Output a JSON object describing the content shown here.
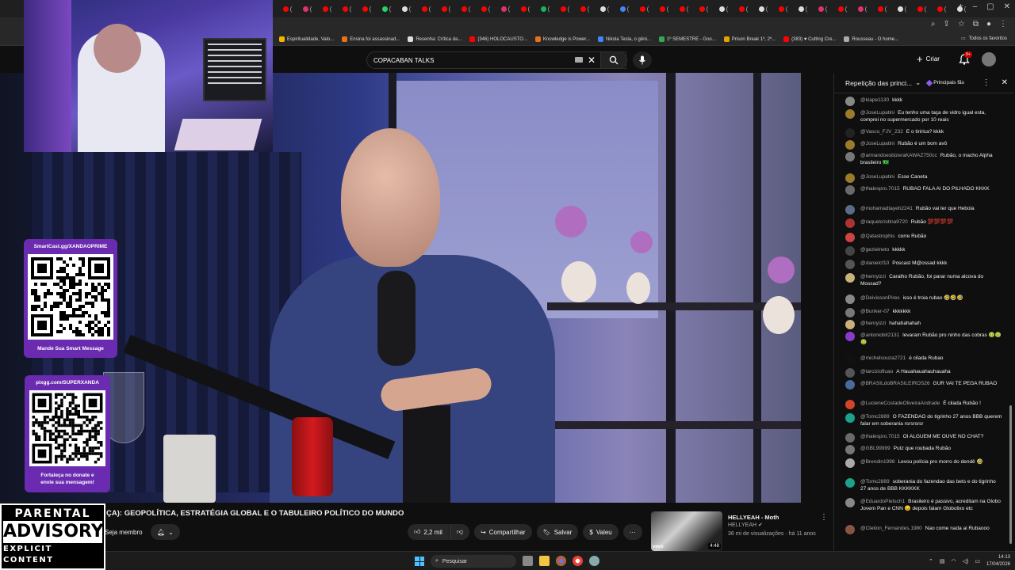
{
  "browser": {
    "tab_count": 38,
    "tab_colors": [
      "#ff0000",
      "#e1306c",
      "#ff0000",
      "#ff0000",
      "#ff0000",
      "#25d366",
      "#dddddd",
      "#ff0000",
      "#ff0000",
      "#ff0000",
      "#ff0000",
      "#e1306c",
      "#ff0000",
      "#19b35c",
      "#ff0000",
      "#ff0000",
      "#dddddd",
      "#4285f4",
      "#ff0000",
      "#ff0000",
      "#ff0000",
      "#ff0000",
      "#dddddd",
      "#ff0000",
      "#dddddd",
      "#ff0000",
      "#dddddd",
      "#e1306c",
      "#ff0000",
      "#e1306c",
      "#ff0000",
      "#dddddd",
      "#ff0000",
      "#ff0000",
      "#dddddd"
    ],
    "new_tab_label": "+",
    "bookmarks": [
      {
        "label": "Espiritualidade, Valo...",
        "color": "#f4b400"
      },
      {
        "label": "Ensina foi assassinad...",
        "color": "#e8711a"
      },
      {
        "label": "Resenha: Crítica da...",
        "color": "#dddddd"
      },
      {
        "label": "(346) HOLOCAUSTO...",
        "color": "#ff0000"
      },
      {
        "label": "Knowledge is Power...",
        "color": "#e8711a"
      },
      {
        "label": "Nikola Tesla, o gêni...",
        "color": "#4285f4"
      },
      {
        "label": "1º SEMESTRE - Goo...",
        "color": "#34a853"
      },
      {
        "label": "Prison Break 1º, 2º...",
        "color": "#e8a200"
      },
      {
        "label": "(383) ♥ Cutting Cre...",
        "color": "#ff0000"
      },
      {
        "label": "Rousseau - O home...",
        "color": "#aaaaaa"
      }
    ],
    "all_favorites": "Todos os favoritos"
  },
  "youtube": {
    "search_value": "COPACABAN TALKS",
    "create_label": "Criar",
    "notif_badge": "9+"
  },
  "overlay": {
    "smartcast": {
      "title": "SmartCast.gg/XANDAOPRIME",
      "footer": "Mande Sua Smart Message"
    },
    "pix": {
      "title": "pixgg.com/SUPERXANDA",
      "footer_line1": "Fortaleça no donate e",
      "footer_line2": "envie sua mensagem!"
    },
    "parental": {
      "line1": "PARENTAL",
      "line2": "ADVISORY",
      "line3": "EXPLICIT CONTENT"
    }
  },
  "video": {
    "title": "ÇA): GEOPOLÍTICA, ESTRATÉGIA GLOBAL E O TABULEIRO POLÍTICO DO MUNDO",
    "join_label": "Seja membro",
    "likes": "2,2 mil",
    "share_label": "Compartilhar",
    "save_label": "Salvar",
    "thanks_label": "Valeu"
  },
  "recommended": {
    "title": "HELLYEAH - Moth",
    "channel": "HELLYEAH",
    "meta": "36 mi de visualizações · há 11 anos",
    "duration": "4:48",
    "badge": "vevo"
  },
  "chat": {
    "header": "Repetição das princi...",
    "top_label": "Principais fãs",
    "messages": [
      {
        "author": "@kiape1130",
        "text": "kkkk",
        "color": "#888888"
      },
      {
        "author": "@JoseLupatini",
        "text": "Eu tenho uma taça de vidro igual esta, comprei no supermercado por 10 reais",
        "color": "#9b7a2a"
      },
      {
        "author": "@Vasco_FJV_232",
        "text": "E o tiririca? kkkk",
        "color": "#222222"
      },
      {
        "author": "@JoseLupatini",
        "text": "Rubão é um bom avô",
        "color": "#9b7a2a"
      },
      {
        "author": "@armandoesbizeraKAWAZ750cc",
        "text": "Rubão, o macho Alpha brasileiro 🇧🇷",
        "color": "#777777"
      },
      {
        "author": "@JoseLupatini",
        "text": "Esse Caneta",
        "color": "#9b7a2a"
      },
      {
        "author": "@thalespro.7015",
        "text": "RUBAO FALA AI DO PILHADO KKKK",
        "color": "#6a6a6a"
      },
      {
        "author": "@mohamadtayeh2241",
        "text": "Rubão vai ter que Hebola",
        "color": "#5b6b8a"
      },
      {
        "author": "@raquelcristina9720",
        "text": "Rubão 💯💯💯💯",
        "color": "#aa3333"
      },
      {
        "author": "@Qatastrophis",
        "text": "corre Rubão",
        "color": "#cc4444"
      },
      {
        "author": "@gezielneto",
        "text": "kkkkk",
        "color": "#444444"
      },
      {
        "author": "@danielcf10",
        "text": "Poscast M@ossad kkkk",
        "color": "#555555"
      },
      {
        "author": "@henryizzi",
        "text": "Caralho Rubão, foi parar numa alcova do Mossad?",
        "color": "#c9b27a"
      },
      {
        "author": "@DeivissonPires",
        "text": "isso é troia rubao 🤣🤣🤣",
        "color": "#888888"
      },
      {
        "author": "@Bunker-07",
        "text": "kkkkkkk",
        "color": "#777777"
      },
      {
        "author": "@henryizzi",
        "text": "hahahahahah",
        "color": "#c9b27a"
      },
      {
        "author": "@antoniobit2131",
        "text": "levaram Rubão pro ninho das cobras 🤢🤢🤢",
        "color": "#8a3ac8"
      },
      {
        "author": "@michelsouza2721",
        "text": "é cilada Rubao",
        "color": "#111111"
      },
      {
        "author": "@tarciziofluao",
        "text": "A Hauahauahauhauaha",
        "color": "#555555"
      },
      {
        "author": "@BRASILdoBRASILEIROS26",
        "text": "GUR VAI TE PEGA RUBAO",
        "color": "#4a6a9a"
      },
      {
        "author": "@LucieneCostadeOliveiraAndrade",
        "text": "É cilada Rubão !",
        "color": "#d2452a"
      },
      {
        "author": "@Tomc2889",
        "text": "O FAZENDAO do tigrinho 27 anos BBB querem falar em soberania rsrsrsrsr",
        "color": "#1aa38a"
      },
      {
        "author": "@thalespro.7015",
        "text": "OI ALGUEM ME OUVE NO CHAT?",
        "color": "#6a6a6a"
      },
      {
        "author": "@GBL99999",
        "text": "Putz que roubada Rubão",
        "color": "#777777"
      },
      {
        "author": "@Brendin1998",
        "text": "Levou polícia pro morro do dendê 🤣",
        "color": "#aaaaaa"
      },
      {
        "author": "@Tomc2889",
        "text": "soberania do fazendao das bets e do tigrinho 27 anos de BBB KKKKKK",
        "color": "#1aa38a"
      },
      {
        "author": "@EduardoPletsch1",
        "text": "Brasileiro é passivo, acreditam na Globo Jovem Pan e CNN 😠 depois falam Globolixo etc",
        "color": "#888888"
      },
      {
        "author": "@Cleiton_Fernandes.1980",
        "text": "Nao come nada ai Rubaooo",
        "color": "#885544"
      }
    ]
  },
  "taskbar": {
    "search_placeholder": "Pesquisar",
    "time": "14:13",
    "date": "17/04/2026"
  }
}
